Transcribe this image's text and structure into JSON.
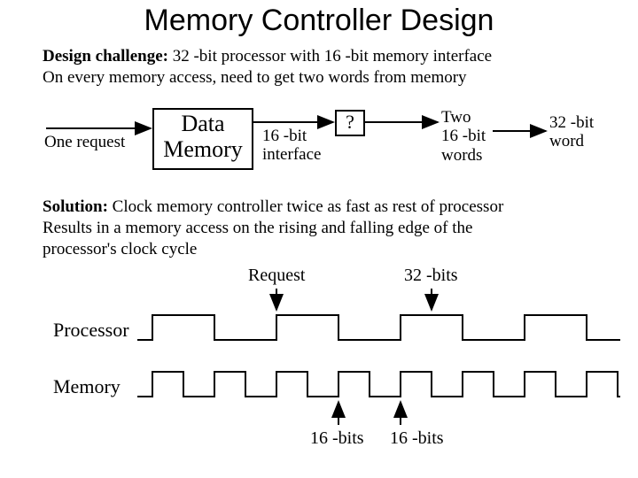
{
  "title": "Memory Controller Design",
  "challenge": {
    "label": "Design challenge:",
    "text": " 32 -bit processor with 16 -bit memory interface",
    "line2": "On every memory access, need to get two words from memory"
  },
  "block": {
    "one_request": "One request",
    "data_memory_l1": "Data",
    "data_memory_l2": "Memory",
    "interface_l1": "16 -bit",
    "interface_l2": "interface",
    "question": "?",
    "two_words_l1": "Two",
    "two_words_l2": "16 -bit",
    "two_words_l3": "words",
    "output_l1": "32 -bit",
    "output_l2": "word"
  },
  "solution": {
    "label": "Solution:",
    "rest": " Clock memory controller twice as fast as rest of processor",
    "line2": "Results in a memory access on the rising and falling edge of the",
    "line3": "processor's clock cycle"
  },
  "timing": {
    "request": "Request",
    "bits32": "32 -bits",
    "processor": "Processor",
    "memory": "Memory",
    "bits16a": "16 -bits",
    "bits16b": "16 -bits"
  },
  "chart_data": {
    "type": "timing-diagram",
    "signals": [
      {
        "name": "Processor",
        "period": 140,
        "duty": 0.5,
        "cycles_shown": 4,
        "annotations": [
          {
            "event": "rising-edge",
            "label": "Request"
          },
          {
            "event": "falling-edge",
            "label": "32-bits"
          }
        ]
      },
      {
        "name": "Memory",
        "period": 70,
        "duty": 0.5,
        "cycles_shown": 8,
        "annotations": [
          {
            "event": "rising-edge",
            "label": "16-bits"
          },
          {
            "event": "rising-edge",
            "label": "16-bits"
          }
        ]
      }
    ],
    "relationship": "Memory clock is 2× Processor clock; two 16-bit accesses per 32-bit processor cycle"
  }
}
